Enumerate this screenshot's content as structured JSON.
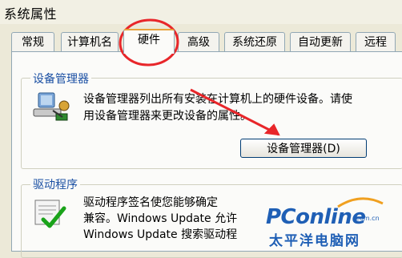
{
  "window": {
    "title": "系统属性"
  },
  "tabs": [
    {
      "label": "常规"
    },
    {
      "label": "计算机名"
    },
    {
      "label": "硬件"
    },
    {
      "label": "高级"
    },
    {
      "label": "系统还原"
    },
    {
      "label": "自动更新"
    },
    {
      "label": "远程"
    }
  ],
  "active_tab": "硬件",
  "device_manager": {
    "title": "设备管理器",
    "desc_line1": "设备管理器列出所有安装在计算机上的硬件设备。请使",
    "desc_line2": "用设备管理器来更改设备的属性。",
    "button_label": "设备管理器(D)"
  },
  "drivers": {
    "title": "驱动程序",
    "desc_line1": "驱动程序签名使您能够确定",
    "desc_line2": "兼容。Windows Update 允许",
    "desc_line3": "Windows Update 搜索驱动程"
  },
  "watermark": {
    "main": "PConline",
    "domain": ".com.cn",
    "sub": "太平洋电脑网"
  },
  "colors": {
    "annotation": "#e8262a",
    "group_title": "#1a4fa3",
    "logo": "#1f5fb5"
  }
}
